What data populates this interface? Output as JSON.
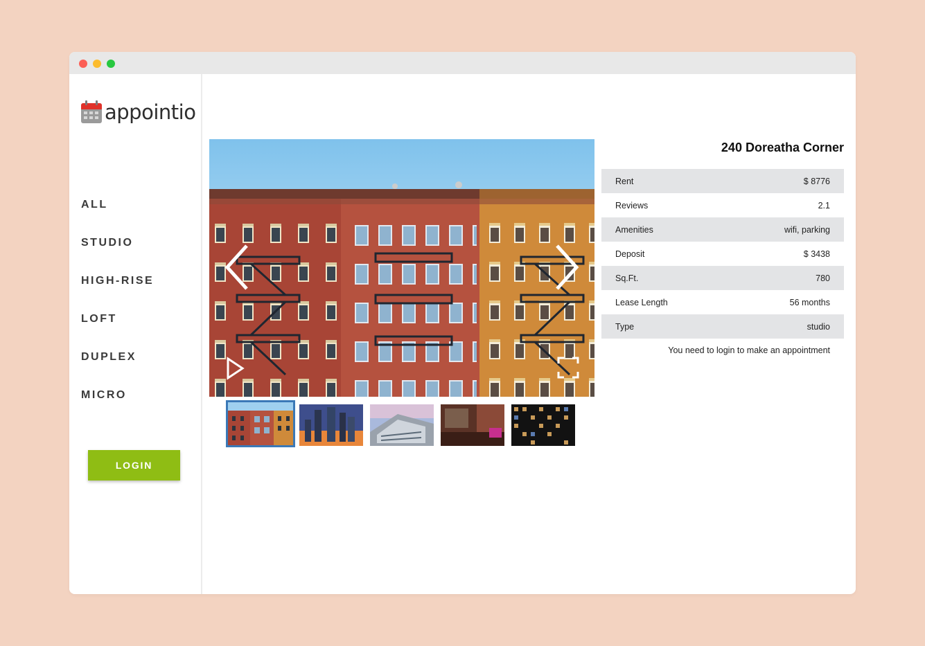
{
  "window": {
    "controls": [
      "close",
      "minimize",
      "maximize"
    ]
  },
  "sidebar": {
    "logo_text": "appointio",
    "nav": [
      {
        "label": "ALL"
      },
      {
        "label": "STUDIO"
      },
      {
        "label": "HIGH-RISE"
      },
      {
        "label": "LOFT"
      },
      {
        "label": "DUPLEX"
      },
      {
        "label": "MICRO"
      }
    ],
    "login_label": "LOGIN"
  },
  "gallery": {
    "icons": {
      "prev": "chevron-left-icon",
      "next": "chevron-right-icon",
      "play": "play-icon",
      "fullscreen": "fullscreen-icon"
    },
    "active_thumbnail": 1,
    "thumbnail_count": 5
  },
  "property": {
    "title": "240 Doreatha Corner",
    "rows": [
      {
        "label": "Rent",
        "value": "$ 8776"
      },
      {
        "label": "Reviews",
        "value": "2.1"
      },
      {
        "label": "Amenities",
        "value": "wifi, parking"
      },
      {
        "label": "Deposit",
        "value": "$ 3438"
      },
      {
        "label": "Sq.Ft.",
        "value": "780"
      },
      {
        "label": "Lease Length",
        "value": "56 months"
      },
      {
        "label": "Type",
        "value": "studio"
      }
    ],
    "note": "You need to login to make an appointment"
  },
  "colors": {
    "background": "#f3d3c1",
    "accent_green": "#8fbd14",
    "active_thumb_border": "#3b79b7",
    "row_shade": "#e3e4e6"
  }
}
